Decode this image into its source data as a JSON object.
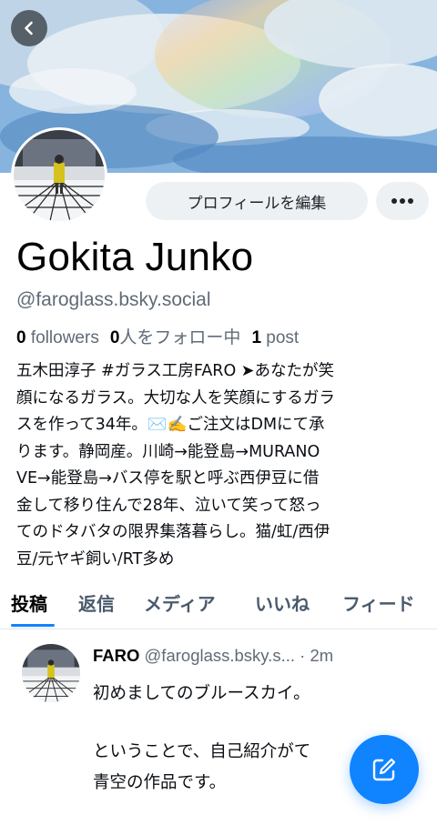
{
  "profile": {
    "display_name": "Gokita Junko",
    "handle": "@faroglass.bsky.social",
    "stats": {
      "followers_count": "0",
      "followers_label": "followers",
      "following_count": "0",
      "following_label": "人をフォロー中",
      "posts_count": "1",
      "posts_label": "post"
    },
    "bio_lines": [
      "五木田淳子 #ガラス工房FARO ➤あなたが笑",
      "顔になるガラス。大切な人を笑顔にするガラ",
      "スを作って34年。✉️✍️ご注文はDMにて承",
      "ります。静岡産。川崎→能登島→MURANO",
      "VE→能登島→バス停を駅と呼ぶ西伊豆に借",
      "金して移り住んで28年、泣いて笑って怒っ",
      "てのドタバタの限界集落暮らし。猫/虹/西伊",
      "豆/元ヤギ飼い/RT多め"
    ]
  },
  "actions": {
    "edit_profile": "プロフィールを編集",
    "more_icon": "ellipsis-icon",
    "back_icon": "chevron-left-icon",
    "compose_icon": "compose-icon"
  },
  "tabs": [
    {
      "label": "投稿",
      "active": true
    },
    {
      "label": "返信",
      "active": false
    },
    {
      "label": "メディア",
      "active": false
    },
    {
      "label": "いいね",
      "active": false
    },
    {
      "label": "フィード",
      "active": false
    }
  ],
  "post": {
    "author": "FARO",
    "handle": "@faroglass.bsky.s...",
    "time": "· 2m",
    "lines": [
      "初めましてのブルースカイ。",
      "",
      "ということで、自己紹介がて",
      "青空の作品です。"
    ]
  },
  "colors": {
    "accent": "#1083fe",
    "muted_text": "#5f6b77",
    "tab_inactive": "#4a5a6c",
    "button_bg": "#eef1f4"
  }
}
